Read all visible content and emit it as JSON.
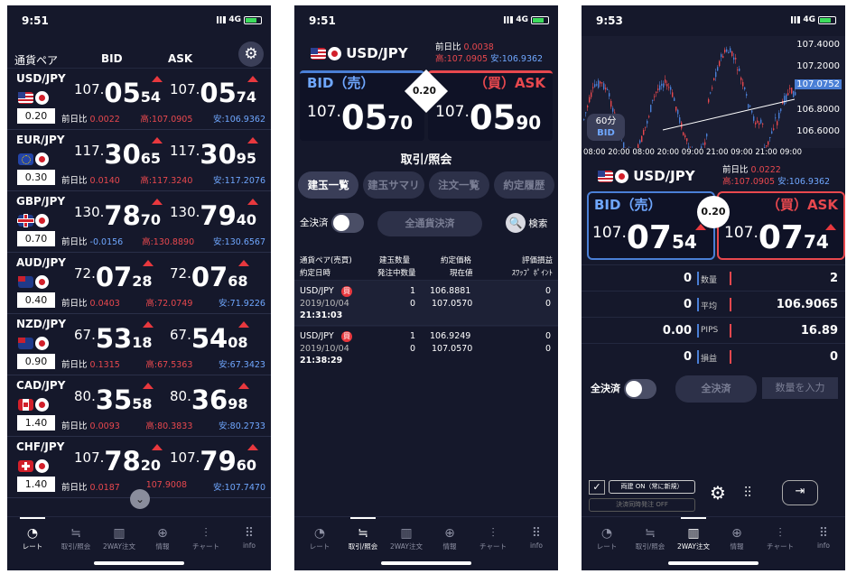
{
  "status": {
    "p1_time": "9:51",
    "p2_time": "9:51",
    "p3_time": "9:53",
    "network": "4G"
  },
  "rate_list": {
    "headers": {
      "pair": "通貨ペア",
      "bid": "BID",
      "ask": "ASK"
    },
    "rows": [
      {
        "pair": "USD/JPY",
        "flag": "us",
        "spread": "0.20",
        "bid": {
          "a": "107.",
          "b": "05",
          "c": "54"
        },
        "ask": {
          "a": "107.",
          "b": "05",
          "c": "74"
        },
        "chg_label": "前日比",
        "chg": "0.0022",
        "chg_color": "red",
        "high": "高:107.0905",
        "low": "安:106.9362"
      },
      {
        "pair": "EUR/JPY",
        "flag": "eu",
        "spread": "0.30",
        "bid": {
          "a": "117.",
          "b": "30",
          "c": "65"
        },
        "ask": {
          "a": "117.",
          "b": "30",
          "c": "95"
        },
        "chg_label": "前日比",
        "chg": "0.0140",
        "chg_color": "red",
        "high": "高:117.3240",
        "low": "安:117.2076"
      },
      {
        "pair": "GBP/JPY",
        "flag": "gb",
        "spread": "0.70",
        "bid": {
          "a": "130.",
          "b": "78",
          "c": "70"
        },
        "ask": {
          "a": "130.",
          "b": "79",
          "c": "40"
        },
        "chg_label": "前日比",
        "chg": "-0.0156",
        "chg_color": "blue",
        "high": "高:130.8890",
        "low": "安:130.6567"
      },
      {
        "pair": "AUD/JPY",
        "flag": "au",
        "spread": "0.40",
        "bid": {
          "a": "72.",
          "b": "07",
          "c": "28"
        },
        "ask": {
          "a": "72.",
          "b": "07",
          "c": "68"
        },
        "chg_label": "前日比",
        "chg": "0.0403",
        "chg_color": "red",
        "high": "高:72.0749",
        "low": "安:71.9226"
      },
      {
        "pair": "NZD/JPY",
        "flag": "nz",
        "spread": "0.90",
        "bid": {
          "a": "67.",
          "b": "53",
          "c": "18"
        },
        "ask": {
          "a": "67.",
          "b": "54",
          "c": "08"
        },
        "chg_label": "前日比",
        "chg": "0.1315",
        "chg_color": "red",
        "high": "高:67.5363",
        "low": "安:67.3423"
      },
      {
        "pair": "CAD/JPY",
        "flag": "ca",
        "spread": "1.40",
        "bid": {
          "a": "80.",
          "b": "35",
          "c": "58"
        },
        "ask": {
          "a": "80.",
          "b": "36",
          "c": "98"
        },
        "chg_label": "前日比",
        "chg": "0.0093",
        "chg_color": "red",
        "high": "高:80.3833",
        "low": "安:80.2733"
      },
      {
        "pair": "CHF/JPY",
        "flag": "ch",
        "spread": "1.40",
        "bid": {
          "a": "107.",
          "b": "78",
          "c": "20"
        },
        "ask": {
          "a": "107.",
          "b": "79",
          "c": "60"
        },
        "chg_label": "前日比",
        "chg": "0.0187",
        "chg_color": "red",
        "high": "107.9008",
        "low": "安:107.7470"
      }
    ]
  },
  "tabs": [
    {
      "label": "レート",
      "icon": "rate-icon"
    },
    {
      "label": "取引/照会",
      "icon": "trade-icon"
    },
    {
      "label": "2WAY注文",
      "icon": "twoway-icon"
    },
    {
      "label": "情報",
      "icon": "info-globe-icon"
    },
    {
      "label": "チャート",
      "icon": "chart-icon"
    },
    {
      "label": "info",
      "icon": "grid-icon"
    }
  ],
  "trade": {
    "pair": "USD/JPY",
    "chg_label": "前日比",
    "chg": "0.0038",
    "high": "高:107.0905",
    "low": "安:106.9362",
    "bid_label": "BID（売）",
    "ask_label": "（買）ASK",
    "spread": "0.20",
    "bid": {
      "a": "107.",
      "b": "05",
      "c": "70"
    },
    "ask": {
      "a": "107.",
      "b": "05",
      "c": "90"
    },
    "section_title": "取引/照会",
    "seg_tabs": [
      "建玉一覧",
      "建玉サマリ",
      "注文一覧",
      "約定履歴"
    ],
    "close_all_label": "全決済",
    "close_all_pairs": "全通貨決済",
    "search": "検索",
    "col_headers": {
      "c1a": "通貨ペア(売買)",
      "c1b": "約定日時",
      "c2a": "建玉数量",
      "c2b": "発注中数量",
      "c3a": "約定価格",
      "c3b": "現在値",
      "c4a": "評価損益",
      "c4b": "ｽﾜｯﾌﾟ ﾎﾟｲﾝﾄ"
    },
    "positions": [
      {
        "pair": "USD/JPY",
        "side": "買",
        "date": "2019/10/04",
        "time": "21:31:03",
        "qty": "1",
        "ordering": "0",
        "price": "106.8881",
        "current": "107.0570",
        "pl": "0",
        "swap": "0"
      },
      {
        "pair": "USD/JPY",
        "side": "買",
        "date": "2019/10/04",
        "time": "21:38:29",
        "qty": "1",
        "ordering": "0",
        "price": "106.9249",
        "current": "107.0570",
        "pl": "0",
        "swap": "0"
      }
    ]
  },
  "twoway": {
    "y_ticks": [
      "107.4000",
      "107.2000",
      "107.0752",
      "106.8000",
      "106.6000"
    ],
    "x_ticks": "08:00 20:00 08:00 20:00 09:00 21:00 09:00 21:00 09:00",
    "timeframe": "60分",
    "timeframe_side": "BID",
    "pair": "USD/JPY",
    "chg_label": "前日比",
    "chg": "0.0222",
    "high": "高:107.0905",
    "low": "安:106.9362",
    "bid_label": "BID（売）",
    "ask_label": "（買）ASK",
    "spread": "0.20",
    "bid": {
      "a": "107.",
      "b": "07",
      "c": "54"
    },
    "ask": {
      "a": "107.",
      "b": "07",
      "c": "74"
    },
    "table": [
      {
        "left": "0",
        "label": "数量",
        "right": "2"
      },
      {
        "left": "0",
        "label": "平均",
        "right": "106.9065"
      },
      {
        "left": "0.00",
        "label": "PIPS",
        "right": "16.89"
      },
      {
        "left": "0",
        "label": "損益",
        "right": "0"
      }
    ],
    "close_all_label": "全決済",
    "close_all_btn": "全決済",
    "qty_placeholder": "数量を入力",
    "oco_label": "両建 ON（常に新規）",
    "simul_label": "決済同時発注 OFF"
  },
  "colors": {
    "bg": "#15182b",
    "red": "#e8484e",
    "blue": "#6fa7ff",
    "bid_border": "#4a7fd6",
    "ask_border": "#e8484e"
  }
}
